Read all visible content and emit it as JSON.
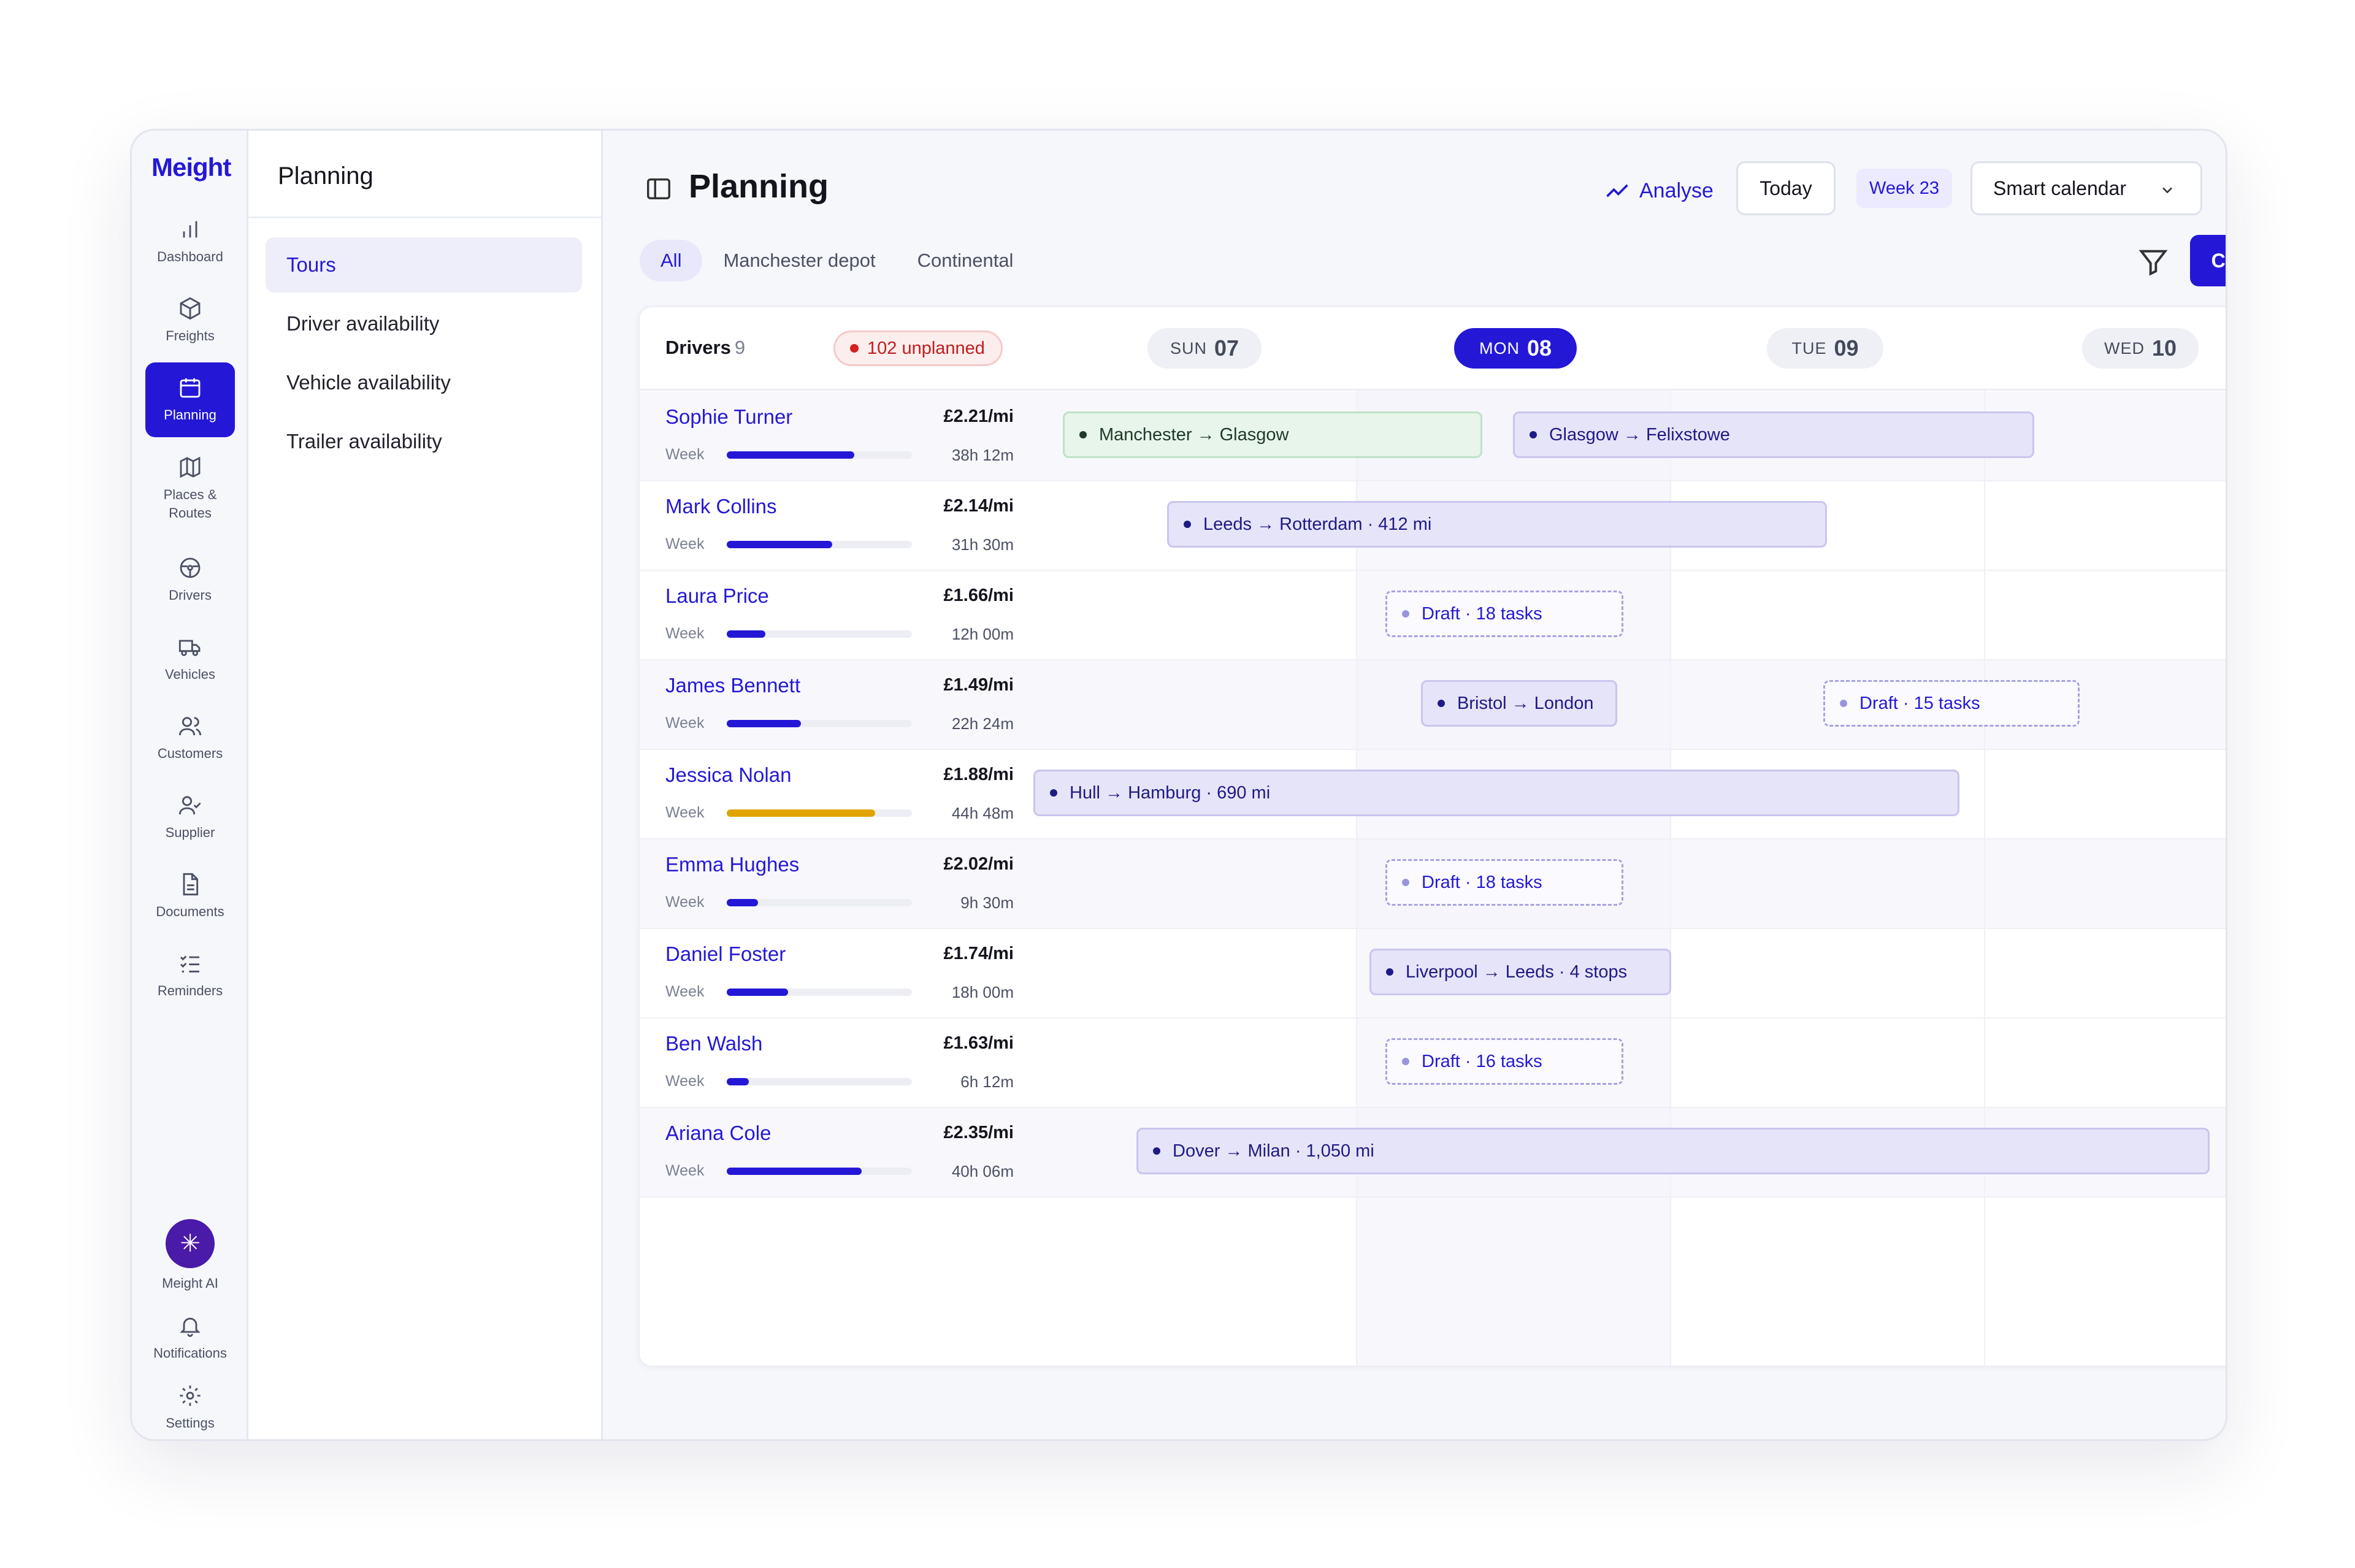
{
  "app": {
    "logo": "Meight",
    "nav": [
      {
        "label": "Dashboard",
        "icon": "bar-chart-icon"
      },
      {
        "label": "Freights",
        "icon": "box-icon"
      },
      {
        "label": "Planning",
        "icon": "calendar-icon",
        "active": true
      },
      {
        "label": "Places & Routes",
        "icon": "map-icon"
      },
      {
        "label": "Drivers",
        "icon": "steering-wheel-icon"
      },
      {
        "label": "Vehicles",
        "icon": "truck-icon"
      },
      {
        "label": "Customers",
        "icon": "users-icon"
      },
      {
        "label": "Supplier",
        "icon": "user-check-icon"
      },
      {
        "label": "Documents",
        "icon": "file-icon"
      },
      {
        "label": "Reminders",
        "icon": "list-checks-icon"
      }
    ],
    "bottom_nav": {
      "ai_label": "Meight AI",
      "ai_glyph": "✳",
      "notifications_label": "Notifications",
      "settings_label": "Settings"
    }
  },
  "subnav": {
    "title": "Planning",
    "items": [
      {
        "label": "Tours",
        "active": true
      },
      {
        "label": "Driver availability"
      },
      {
        "label": "Vehicle availability"
      },
      {
        "label": "Trailer availability"
      }
    ]
  },
  "header": {
    "title": "Planning",
    "analyse_label": "Analyse",
    "today_label": "Today",
    "week_label": "Week 23",
    "calendar_select": "Smart calendar",
    "create_label": "Create tour",
    "filters": [
      {
        "label": "All",
        "active": true
      },
      {
        "label": "Manchester depot"
      },
      {
        "label": "Continental"
      }
    ]
  },
  "board": {
    "drivers_label": "Drivers",
    "drivers_count": "9",
    "unplanned_label": "102 unplanned",
    "days": [
      {
        "name": "SUN",
        "date": "07"
      },
      {
        "name": "MON",
        "date": "08",
        "today": true
      },
      {
        "name": "TUE",
        "date": "09"
      },
      {
        "name": "WED",
        "date": "10"
      }
    ],
    "week_label": "Week",
    "drivers": [
      {
        "name": "Sophie Turner",
        "rate": "£2.21/mi",
        "hours": "38h 12m",
        "utilization": 0.69
      },
      {
        "name": "Mark Collins",
        "rate": "£2.14/mi",
        "hours": "31h 30m",
        "utilization": 0.57
      },
      {
        "name": "Laura Price",
        "rate": "£1.66/mi",
        "hours": "12h 00m",
        "utilization": 0.21
      },
      {
        "name": "James Bennett",
        "rate": "£1.49/mi",
        "hours": "22h 24m",
        "utilization": 0.4
      },
      {
        "name": "Jessica Nolan",
        "rate": "£1.88/mi",
        "hours": "44h 48m",
        "utilization": 0.8,
        "warn": true
      },
      {
        "name": "Emma Hughes",
        "rate": "£2.02/mi",
        "hours": "9h 30m",
        "utilization": 0.17
      },
      {
        "name": "Daniel Foster",
        "rate": "£1.74/mi",
        "hours": "18h 00m",
        "utilization": 0.33
      },
      {
        "name": "Ben Walsh",
        "rate": "£1.63/mi",
        "hours": "6h 12m",
        "utilization": 0.12
      },
      {
        "name": "Ariana Cole",
        "rate": "£2.35/mi",
        "hours": "40h 06m",
        "utilization": 0.73
      }
    ],
    "tours": {
      "t0a": "Manchester → Glasgow",
      "t0b": "Glasgow → Felixstowe",
      "t1": "Leeds → Rotterdam · 412 mi",
      "t2": "Draft · 18 tasks",
      "t3a": "Bristol → London",
      "t3b": "Draft · 15 tasks",
      "t4": "Hull → Hamburg · 690 mi",
      "t5": "Draft · 18 tasks",
      "t6": "Liverpool → Leeds · 4 stops",
      "t7": "Draft · 16 tasks",
      "t8": "Dover → Milan · 1,050 mi"
    }
  }
}
